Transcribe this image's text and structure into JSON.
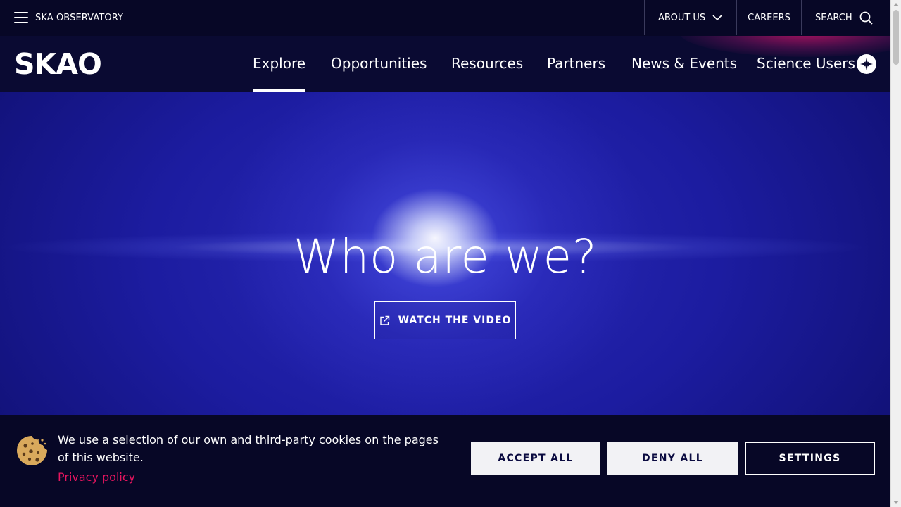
{
  "topbar": {
    "menu_label": "SKA OBSERVATORY",
    "about_label": "ABOUT US",
    "careers_label": "CAREERS",
    "search_label": "SEARCH"
  },
  "nav": {
    "logo": "SKAO",
    "items": [
      "Explore",
      "Opportunities",
      "Resources",
      "Partners",
      "News & Events",
      "Science Users"
    ],
    "active": "Explore"
  },
  "hero": {
    "title": "Who are we?",
    "button_label": "WATCH THE VIDEO"
  },
  "cookie_banner": {
    "text": "We use a selection of our own and third-party cookies on the pages of this website.",
    "privacy_link": "Privacy policy",
    "accept_label": "ACCEPT ALL",
    "deny_label": "DENY ALL",
    "settings_label": "SETTINGS"
  },
  "icons": {
    "menu": "hamburger-menu-icon",
    "about_dropdown": "chevron-down-icon",
    "search": "search-icon",
    "science_users": "compass-icon",
    "video_link": "external-link-icon",
    "cookie": "cookie-icon"
  },
  "colors": {
    "background": "#070726",
    "nav_background": "#0a0a32",
    "accent": "#e8155f",
    "button_light": "#f2f2f5"
  }
}
